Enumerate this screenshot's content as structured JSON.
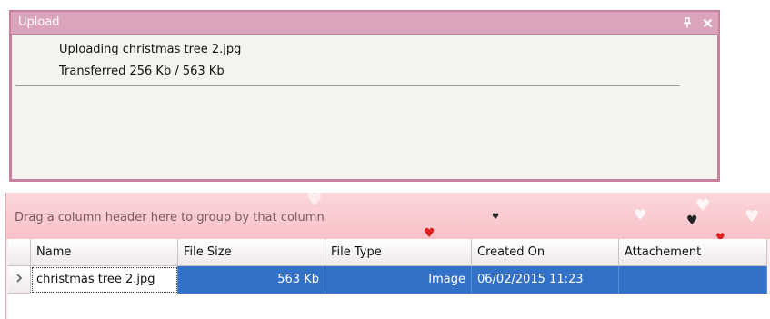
{
  "upload": {
    "title": "Upload",
    "status_line": "Uploading christmas tree 2.jpg",
    "progress_line": "Transferred 256 Kb / 563 Kb",
    "pin_icon": "pin-icon",
    "close_icon": "close-icon"
  },
  "grid": {
    "group_hint": "Drag a column header here to group by that column",
    "columns": [
      "Name",
      "File Size",
      "File Type",
      "Created On",
      "Attachement"
    ],
    "rows": [
      {
        "name": "christmas tree 2.jpg",
        "file_size": "563 Kb",
        "file_type": "Image",
        "created_on": "06/02/2015 11:23",
        "attachement": ""
      }
    ]
  },
  "colors": {
    "panel_border": "#c8809e",
    "title_bar": "#d9a4bc",
    "selection": "#3370c8",
    "group_area": "#f8c2c8"
  }
}
